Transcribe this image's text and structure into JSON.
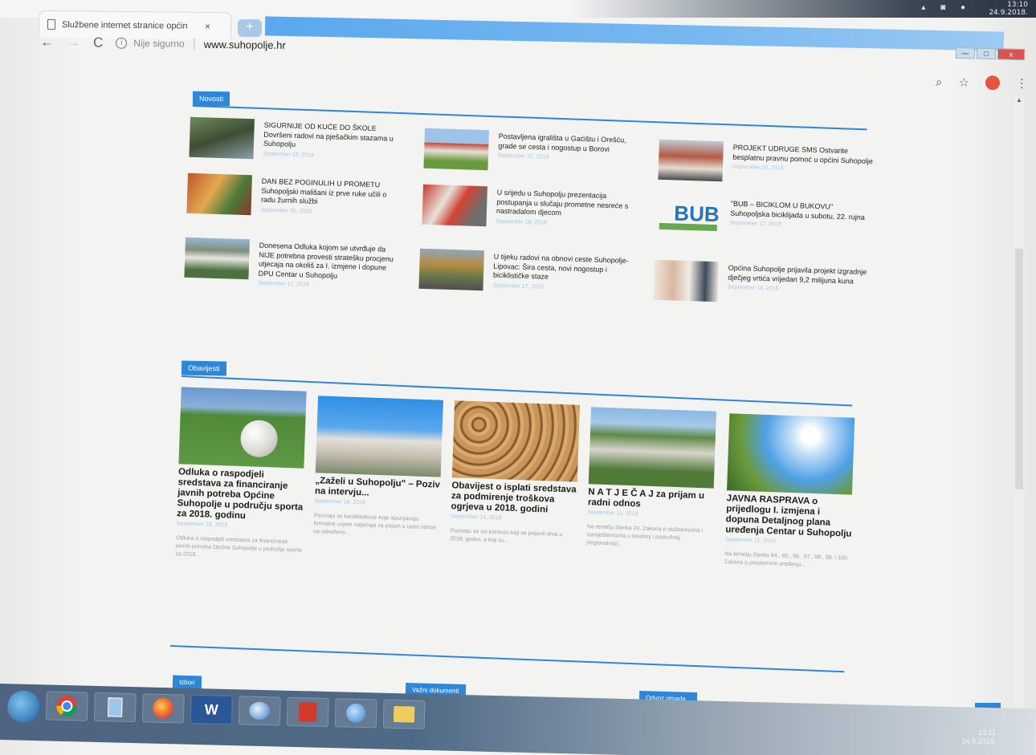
{
  "os": {
    "top_clock_time": "13:10",
    "top_clock_date": "24.9.2018.",
    "taskbar_clock_time": "13:11",
    "taskbar_clock_date": "24.9.2018."
  },
  "browser": {
    "tab_title": "Službene internet stranice općin",
    "tab_close": "×",
    "new_tab": "+",
    "back": "←",
    "forward": "→",
    "reload": "C",
    "info": "i",
    "insecure_label": "Nije sigurno",
    "separator": "|",
    "url": "www.suhopolje.hr",
    "zoom_icon": "⌕",
    "bookmark_icon": "☆",
    "menu_icon": "⋮",
    "win_minimize": "—",
    "win_maximize": "□",
    "win_close": "x"
  },
  "novosti": {
    "section_label": "Novosti",
    "items": [
      {
        "title": "SIGURNIJE OD KUĆE DO ŠKOLE Dovršeni radovi na pješačkim stazama u Suhopolju",
        "date": "September 19, 2018"
      },
      {
        "title": "Postavljena igrališta u Gaćištu i Orešću, grade se cesta i nogostup u Borovi",
        "date": "September 21, 2018"
      },
      {
        "title": "PROJEKT UDRUGE SMS Ostvarite besplatnu pravnu pomoć u općini Suhopolje",
        "date": "September 20, 2018"
      },
      {
        "title": "DAN BEZ POGINULIH U PROMETU Suhopoljski mališani iz prve ruke učili o radu žurnih službi",
        "date": "September 20, 2018"
      },
      {
        "title": "U srijedu u Suhopolju prezentacija postupanja u slučaju prometne nesreće s nastradalom djecom",
        "date": "September 18, 2018"
      },
      {
        "title": "\"BUB – BICIKLOM U BUKOVU\" Suhopoljska biciklijada u subotu, 22. rujna",
        "date": "September 17, 2018"
      },
      {
        "title": "Donesena Odluka kojom se utvrđuje da NIJE potrebna provesti stratešku procjenu utjecaja na okoliš za I. izmjene i dopune DPU Centar u Suhopolju",
        "date": "September 17, 2018"
      },
      {
        "title": "U tijeku radovi na obnovi ceste Suhopolje-Lipovac: Šira cesta, novi nogostup i biciklističke staze",
        "date": "September 17, 2018"
      },
      {
        "title": "Općina Suhopolje prijavila projekt izgradnje dječjeg vrtića vrijedan 9,2 milijuna kuna",
        "date": "September 14, 2018"
      }
    ]
  },
  "obavijesti": {
    "section_label": "Obavijesti",
    "cards": [
      {
        "title": "Odluka o raspodjeli sredstava za financiranje javnih potreba Općine Suhopolje u području sporta za 2018. godinu",
        "date": "September 18, 2018",
        "excerpt": "Odluka o raspodjeli sredstava za financiranje javnih potreba Općine Suhopolje u području sporta za 2018..."
      },
      {
        "title": "„Zaželi u Suhopolju\" – Poziv na intervju...",
        "date": "September 18, 2018",
        "excerpt": "Pozivaju se kandidatkinje koje ispunjavaju formalne uvjete natječaja za prijam u radni odnos na određeno..."
      },
      {
        "title": "Obavijest o isplati sredstava za podmirenje troškova ogrjeva u 2018. godini",
        "date": "September 14, 2018",
        "excerpt": "Pozivaju se svi korisnici koji se prijavili drva u 2018. godini, a koji su..."
      },
      {
        "title": "N A T J E Č A J za prijam u radni odnos",
        "date": "September 11, 2018",
        "excerpt": "Na temelju članka 24. Zakona o službenicima i namještenicima u lokalnoj i područnoj (regionalnoj)..."
      },
      {
        "title": "JAVNA RASPRAVA o prijedlogu I. izmjena i dopuna Detaljnog plana uređenja Centar u Suhopolju",
        "date": "September 11, 2018",
        "excerpt": "Na temelju članka 94., 95., 96., 97., 98., 99. i 100. Zakona o prostornom uređenju..."
      }
    ]
  },
  "footer": {
    "izbori": "Izbori",
    "vazni_dokumenti": "Važni dokumenti",
    "odvoz_otpada": "Odvoz otpada..."
  },
  "scroll_top_label": "^",
  "taskbar": {
    "items": [
      "start-orb",
      "chrome-icon",
      "file-icon",
      "firefox-icon",
      "word-icon",
      "thunderbird-icon",
      "pdf-icon",
      "network-icon",
      "folder-icon"
    ],
    "word_label": "W"
  }
}
